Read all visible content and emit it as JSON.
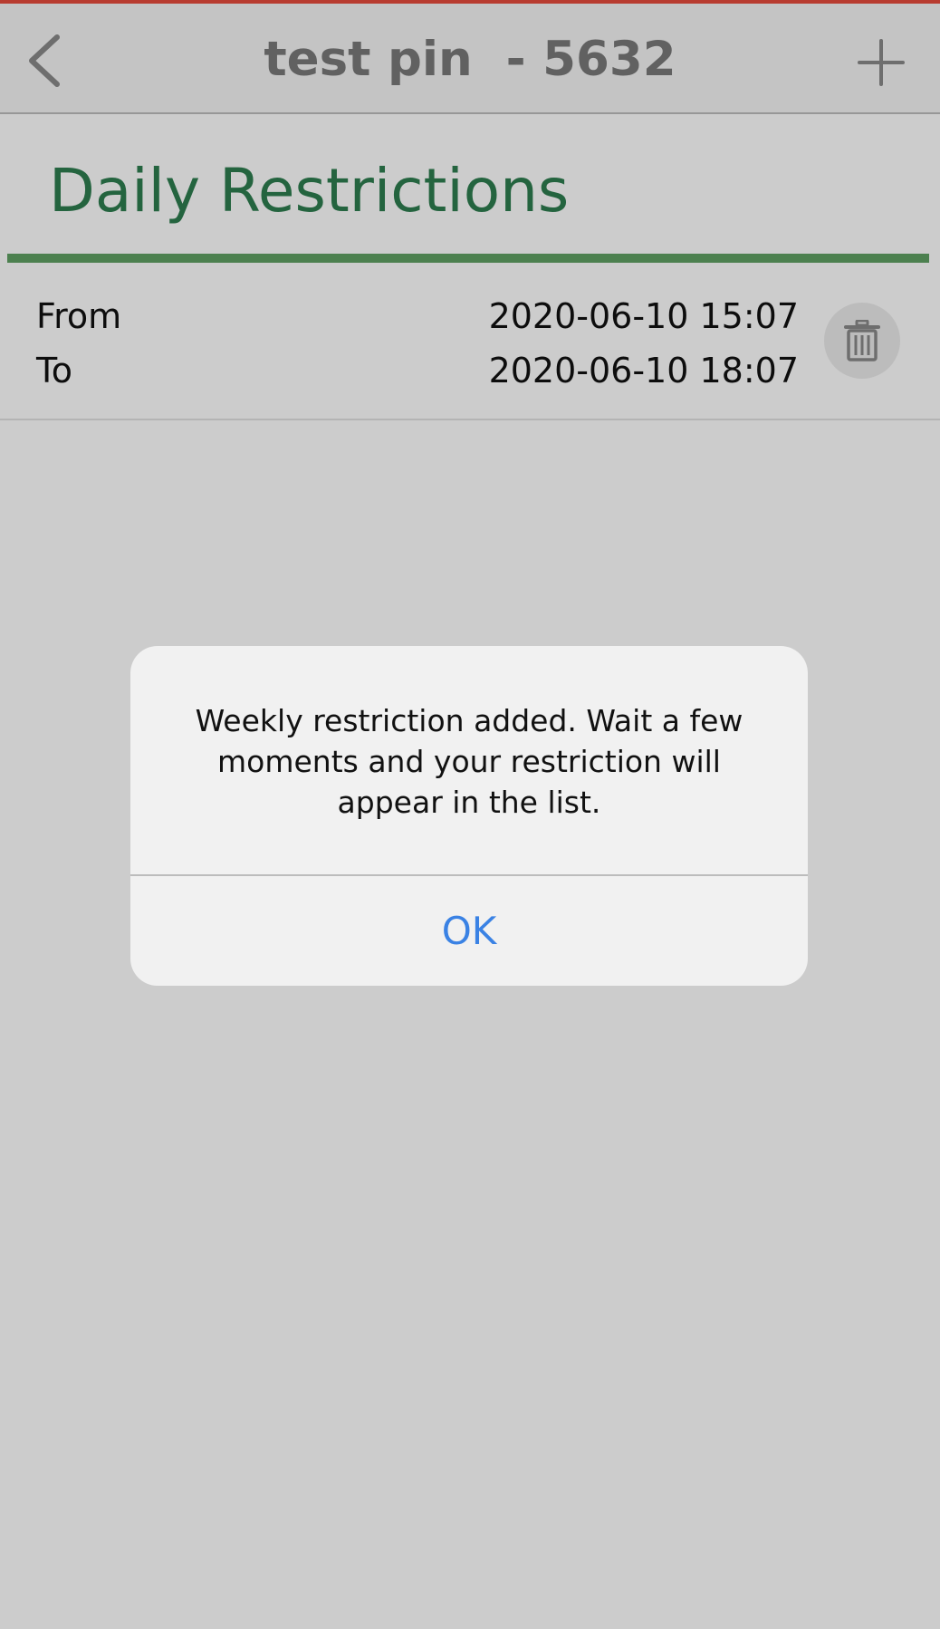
{
  "header": {
    "title": "test pin  - 5632",
    "back_icon": "chevron-left-icon",
    "add_icon": "plus-icon"
  },
  "section": {
    "title": "Daily Restrictions"
  },
  "restrictions": [
    {
      "from_label": "From",
      "from_value": "2020-06-10 15:07",
      "to_label": "To",
      "to_value": "2020-06-10 18:07",
      "delete_icon": "trash-icon"
    }
  ],
  "dialog": {
    "message": "Weekly restriction added. Wait a few moments and your restriction will appear in the list.",
    "ok_label": "OK"
  },
  "colors": {
    "accent_green": "#2e7d4f",
    "rule_green": "#5fa063",
    "link_blue": "#3a82e4",
    "status_red": "#e74c3c"
  }
}
